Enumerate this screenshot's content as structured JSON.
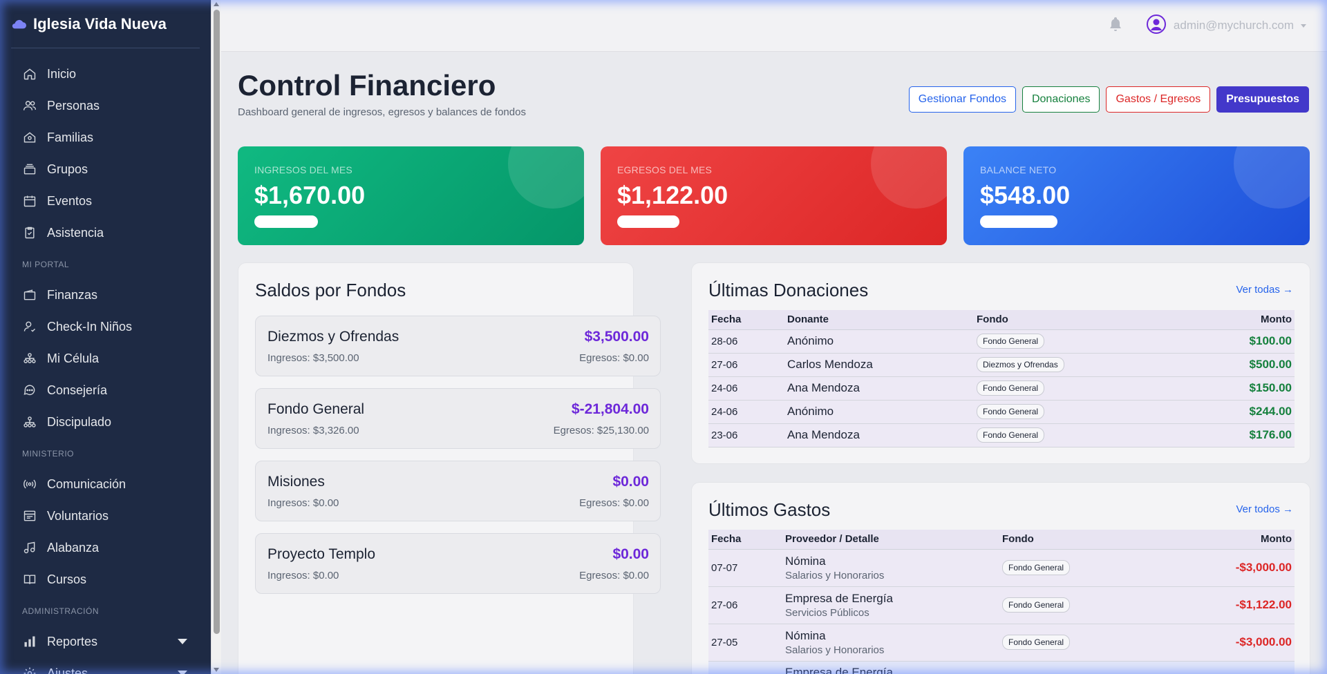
{
  "sidebar": {
    "brand": "Iglesia Vida Nueva",
    "items_top": [
      {
        "label": "Inicio",
        "icon": "home-icon"
      },
      {
        "label": "Personas",
        "icon": "users-icon"
      },
      {
        "label": "Familias",
        "icon": "family-home-icon"
      },
      {
        "label": "Grupos",
        "icon": "layers-icon"
      },
      {
        "label": "Eventos",
        "icon": "calendar-icon"
      },
      {
        "label": "Asistencia",
        "icon": "clipboard-check-icon"
      }
    ],
    "section_portal": "MI PORTAL",
    "items_portal": [
      {
        "label": "Finanzas",
        "icon": "wallet-icon"
      },
      {
        "label": "Check-In Niños",
        "icon": "child-check-icon"
      },
      {
        "label": "Mi Célula",
        "icon": "cell-icon"
      },
      {
        "label": "Consejería",
        "icon": "chat-icon"
      },
      {
        "label": "Discipulado",
        "icon": "hierarchy-icon"
      }
    ],
    "section_ministerio": "MINISTERIO",
    "items_ministerio": [
      {
        "label": "Comunicación",
        "icon": "broadcast-icon"
      },
      {
        "label": "Voluntarios",
        "icon": "list-board-icon"
      },
      {
        "label": "Alabanza",
        "icon": "music-icon"
      },
      {
        "label": "Cursos",
        "icon": "book-icon"
      }
    ],
    "section_admin": "ADMINISTRACIÓN",
    "items_admin": [
      {
        "label": "Reportes",
        "icon": "bar-chart-icon"
      },
      {
        "label": "Ajustes",
        "icon": "gear-icon"
      }
    ]
  },
  "topbar": {
    "user_email": "admin@mychurch.com"
  },
  "header": {
    "title": "Control Financiero",
    "subtitle": "Dashboard general de ingresos, egresos y balances de fondos",
    "buttons": {
      "funds": "Gestionar Fondos",
      "donations": "Donaciones",
      "expenses": "Gastos / Egresos",
      "budgets": "Presupuestos"
    }
  },
  "stats": [
    {
      "label": "INGRESOS DEL MES",
      "value": "$1,670.00"
    },
    {
      "label": "EGRESOS DEL MES",
      "value": "$1,122.00"
    },
    {
      "label": "BALANCE NETO",
      "value": "$548.00"
    }
  ],
  "funds": {
    "title": "Saldos por Fondos",
    "items": [
      {
        "name": "Diezmos y Ofrendas",
        "balance": "$3,500.00",
        "income": "Ingresos: $3,500.00",
        "expense": "Egresos: $0.00"
      },
      {
        "name": "Fondo General",
        "balance": "$-21,804.00",
        "income": "Ingresos: $3,326.00",
        "expense": "Egresos: $25,130.00"
      },
      {
        "name": "Misiones",
        "balance": "$0.00",
        "income": "Ingresos: $0.00",
        "expense": "Egresos: $0.00"
      },
      {
        "name": "Proyecto Templo",
        "balance": "$0.00",
        "income": "Ingresos: $0.00",
        "expense": "Egresos: $0.00"
      }
    ]
  },
  "donations": {
    "title": "Últimas Donaciones",
    "link": "Ver todas →",
    "columns": [
      "Fecha",
      "Donante",
      "Fondo",
      "Monto"
    ],
    "rows": [
      {
        "date": "28-06",
        "donor": "Anónimo",
        "fund": "Fondo General",
        "amount": "$100.00"
      },
      {
        "date": "27-06",
        "donor": "Carlos Mendoza",
        "fund": "Diezmos y Ofrendas",
        "amount": "$500.00"
      },
      {
        "date": "24-06",
        "donor": "Ana Mendoza",
        "fund": "Fondo General",
        "amount": "$150.00"
      },
      {
        "date": "24-06",
        "donor": "Anónimo",
        "fund": "Fondo General",
        "amount": "$244.00"
      },
      {
        "date": "23-06",
        "donor": "Ana Mendoza",
        "fund": "Fondo General",
        "amount": "$176.00"
      }
    ]
  },
  "expenses": {
    "title": "Últimos Gastos",
    "link": "Ver todos →",
    "columns": [
      "Fecha",
      "Proveedor / Detalle",
      "Fondo",
      "Monto"
    ],
    "rows": [
      {
        "date": "07-07",
        "provider": "Nómina",
        "detail": "Salarios y Honorarios",
        "fund": "Fondo General",
        "amount": "-$3,000.00"
      },
      {
        "date": "27-06",
        "provider": "Empresa de Energía",
        "detail": "Servicios Públicos",
        "fund": "Fondo General",
        "amount": "-$1,122.00"
      },
      {
        "date": "27-05",
        "provider": "Nómina",
        "detail": "Salarios y Honorarios",
        "fund": "Fondo General",
        "amount": "-$3,000.00"
      },
      {
        "date": "",
        "provider": "Empresa de Energía",
        "detail": "",
        "fund": "",
        "amount": ""
      }
    ]
  }
}
